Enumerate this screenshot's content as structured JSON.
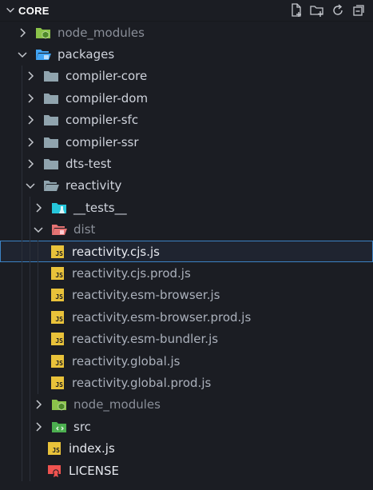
{
  "explorer": {
    "title": "CORE",
    "actions": [
      "new-file-icon",
      "new-folder-icon",
      "refresh-icon",
      "collapse-all-icon"
    ]
  },
  "tree": [
    {
      "label": "node_modules",
      "type": "folder-node",
      "depth": 0,
      "expanded": false,
      "dim": true
    },
    {
      "label": "packages",
      "type": "folder-packages",
      "depth": 0,
      "expanded": true
    },
    {
      "label": "compiler-core",
      "type": "folder",
      "depth": 1,
      "expanded": false
    },
    {
      "label": "compiler-dom",
      "type": "folder",
      "depth": 1,
      "expanded": false
    },
    {
      "label": "compiler-sfc",
      "type": "folder",
      "depth": 1,
      "expanded": false
    },
    {
      "label": "compiler-ssr",
      "type": "folder",
      "depth": 1,
      "expanded": false
    },
    {
      "label": "dts-test",
      "type": "folder",
      "depth": 1,
      "expanded": false
    },
    {
      "label": "reactivity",
      "type": "folder-open",
      "depth": 1,
      "expanded": true
    },
    {
      "label": "__tests__",
      "type": "folder-tests",
      "depth": 2,
      "expanded": false
    },
    {
      "label": "dist",
      "type": "folder-dist",
      "depth": 2,
      "expanded": true,
      "dim": true
    },
    {
      "label": "reactivity.cjs.js",
      "type": "js",
      "depth": 3,
      "selected": true
    },
    {
      "label": "reactivity.cjs.prod.js",
      "type": "js",
      "depth": 3
    },
    {
      "label": "reactivity.esm-browser.js",
      "type": "js",
      "depth": 3
    },
    {
      "label": "reactivity.esm-browser.prod.js",
      "type": "js",
      "depth": 3
    },
    {
      "label": "reactivity.esm-bundler.js",
      "type": "js",
      "depth": 3
    },
    {
      "label": "reactivity.global.js",
      "type": "js",
      "depth": 3
    },
    {
      "label": "reactivity.global.prod.js",
      "type": "js",
      "depth": 3
    },
    {
      "label": "node_modules",
      "type": "folder-node",
      "depth": 2,
      "expanded": false,
      "dim": true
    },
    {
      "label": "src",
      "type": "folder-src",
      "depth": 2,
      "expanded": false
    },
    {
      "label": "index.js",
      "type": "js",
      "depth": 2,
      "file": true
    },
    {
      "label": "LICENSE",
      "type": "license",
      "depth": 2,
      "file": true
    }
  ],
  "colors": {
    "background": "#1b1d23",
    "selection_border": "#3b82c4",
    "js_badge": "#e9c23a",
    "folder": "#90a4ae",
    "node_folder": "#8bc34a",
    "packages_folder": "#42a5f5",
    "dist_folder": "#e57373",
    "tests_folder": "#26c6da",
    "src_folder": "#4caf50",
    "license": "#ef5350"
  }
}
